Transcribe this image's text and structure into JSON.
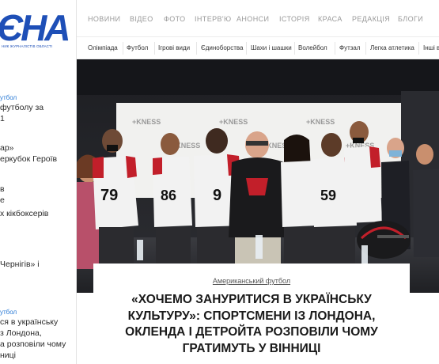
{
  "logo": {
    "text": "ЄНА",
    "subtitle": "НИК ЖУРНАЛІСТІВ ОБЛАСТІ"
  },
  "topnav": {
    "items": [
      "НОВИНИ",
      "ВІДЕО",
      "ФОТО",
      "ІНТЕРВ'Ю",
      "АНОНСИ",
      "ІСТОРІЯ",
      "КРАСА",
      "РЕДАКЦІЯ",
      "БЛОГИ"
    ]
  },
  "subnav": {
    "items": [
      "Олімпіада",
      "Футбол",
      "Ігрові види",
      "Єдиноборства",
      "Шахи і шашки",
      "Волейбол",
      "Футзал",
      "Легка атлетика",
      "Інші в"
    ]
  },
  "sidebar": {
    "news": [
      {
        "category": "утбол",
        "lines": [
          "футболу за",
          "1"
        ]
      },
      {
        "category": "",
        "lines": [
          "ар»",
          "еркубок Героїв"
        ]
      },
      {
        "category": "",
        "lines": [
          "в",
          "e"
        ]
      },
      {
        "category": "",
        "lines": [
          "х кікбоксерів"
        ]
      },
      {
        "category": "",
        "lines": [
          "Чернігів» і"
        ]
      },
      {
        "category": "утбол",
        "lines": [
          "ся в українську",
          "з Лондона,",
          "а розповіли чому",
          "ниці"
        ]
      }
    ]
  },
  "hero": {
    "jersey_numbers": [
      "79",
      "86",
      "9",
      "59"
    ],
    "backdrop_brand": "+KNESS"
  },
  "article": {
    "category": "Американський футбол",
    "title": "«Хочемо зануритися в українську культуру»: спортсмени із Лондона, Окленда і Детройта розповіли чому гратимуть у Вінниці"
  }
}
